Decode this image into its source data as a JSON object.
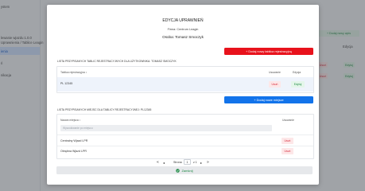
{
  "background": {
    "sidebar_lines": [
      "ystem",
      "lewanie wjazdu 1.0.0",
      "Uprawnienia / Tablice Leagin",
      "ienia",
      "ń",
      "nikacja"
    ],
    "add_button": "+ Dodaj nowy wpis",
    "col_label": "Edycja",
    "row_red": "Usuń",
    "row_green": "Edytuj"
  },
  "modal": {
    "title": "EDYCJA UPRAWNIEŃ",
    "company": "Firma: Centrum Leagin",
    "person": "Osoba: Tomasz Smoczyk",
    "add_plate_button": "+ Dodaj nowy tablica rejestracyjną",
    "plates_section_label": "LISTA PRZYPISANYCH TABLIC REJESTRACYJNYCH DLA UŻYTKOWNIKA: TOMASZ SMOCZYK",
    "plates_table": {
      "col_plate": "Tablica rejestracyjna ↕",
      "col_delete": "Usuwanie",
      "col_edit": "Edycja",
      "rows": [
        {
          "plate": "PL 12345",
          "delete": "Usuń",
          "edit": "Edytuj"
        }
      ]
    },
    "add_place_button": "+ Dodaj nowe miejsce",
    "places_section_label": "LISTA PRZYPISANYCH MIEJSC DLA TABLICY REJESTRACYJNEJ: PL12345",
    "places_table": {
      "col_name": "Nazwa miejsca ↕",
      "col_delete": "Usuwanie",
      "search_placeholder": "Wyszukiwanie po miejscu",
      "rows": [
        {
          "name": "Centralny Wjazd LPR",
          "delete": "Usuń"
        },
        {
          "name": "Obrębna Wjazd LPR",
          "delete": "Usuń"
        }
      ]
    },
    "pagination": {
      "first": "«",
      "prev": "◂",
      "label": "Strona",
      "page": "1",
      "of": "z 1",
      "next": "▸",
      "last": "»"
    },
    "close_button": "Zamknij",
    "close_icon": "check-circle-icon"
  }
}
